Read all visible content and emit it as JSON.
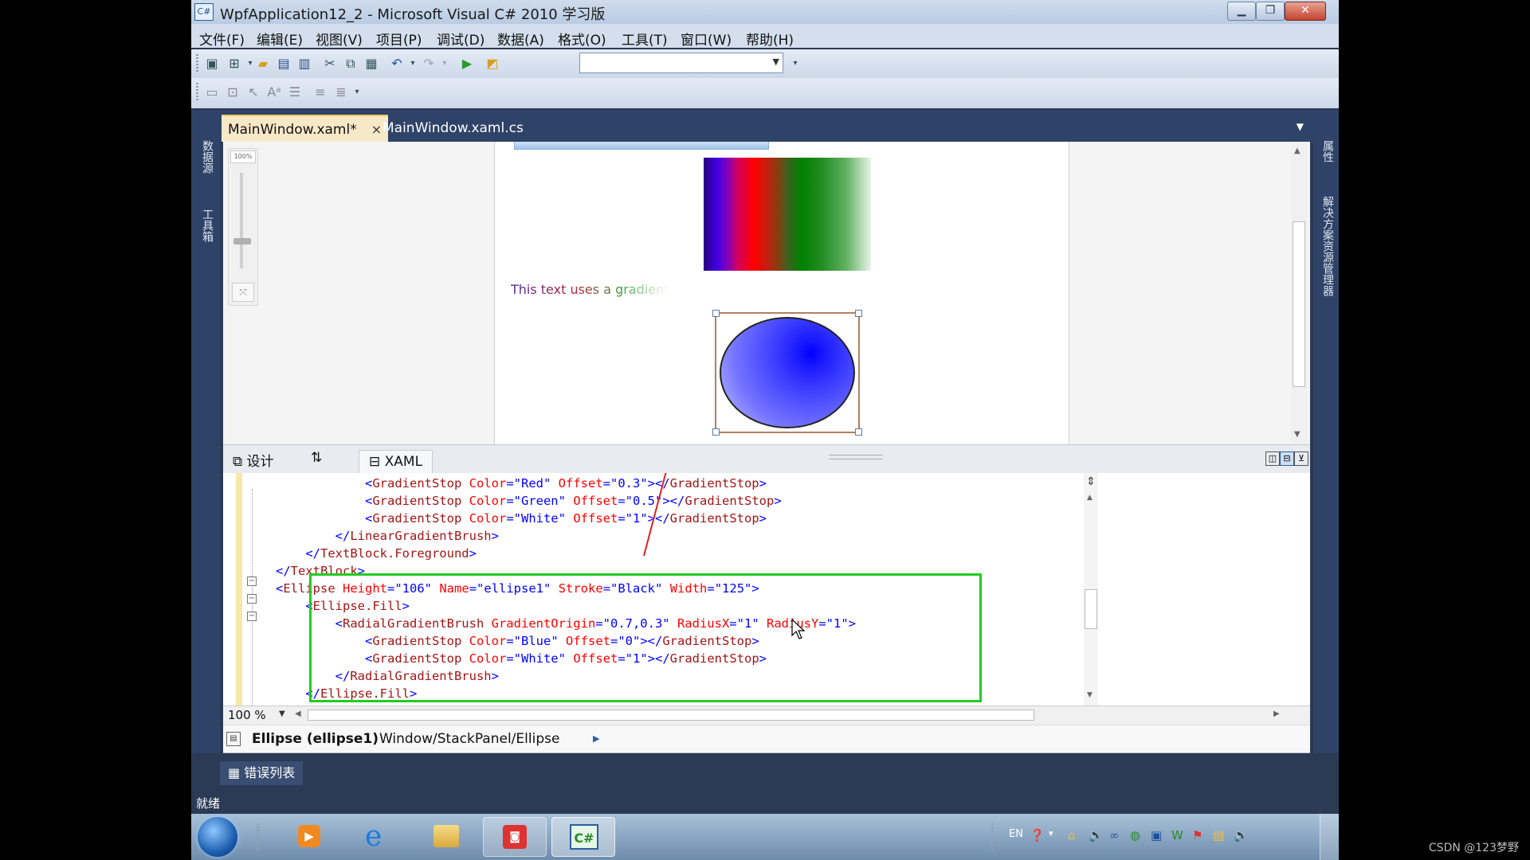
{
  "window": {
    "title": "WpfApplication12_2 - Microsoft Visual C# 2010 学习版",
    "app_icon": "C#"
  },
  "menu": [
    "文件(F)",
    "编辑(E)",
    "视图(V)",
    "项目(P)",
    "调试(D)",
    "数据(A)",
    "格式(O)",
    "工具(T)",
    "窗口(W)",
    "帮助(H)"
  ],
  "left_panel": {
    "item1": "数据源",
    "item2": "工具箱"
  },
  "right_panel": {
    "item1": "属性",
    "item2": "解决方案资源管理器"
  },
  "tabs": [
    {
      "label": "MainWindow.xaml*",
      "close": "×"
    },
    {
      "label": "MainWindow.xaml.cs"
    }
  ],
  "designer": {
    "zoom_label": "100%",
    "textblock_text": "This text uses a gradient"
  },
  "split_tabs": {
    "design": "设计",
    "swap": "⇅",
    "xaml": "XAML"
  },
  "code_lines": [
    {
      "indent": "            ",
      "parts": [
        [
          "pun",
          "<"
        ],
        [
          "tag",
          "GradientStop"
        ],
        [
          "att",
          " Color"
        ],
        [
          "pun",
          "=\""
        ],
        [
          "val",
          "Red"
        ],
        [
          "pun",
          "\""
        ],
        [
          "att",
          " Offset"
        ],
        [
          "pun",
          "=\""
        ],
        [
          "val",
          "0.3"
        ],
        [
          "pun",
          "\"></"
        ],
        [
          "tag",
          "GradientStop"
        ],
        [
          "pun",
          ">"
        ]
      ]
    },
    {
      "indent": "            ",
      "parts": [
        [
          "pun",
          "<"
        ],
        [
          "tag",
          "GradientStop"
        ],
        [
          "att",
          " Color"
        ],
        [
          "pun",
          "=\""
        ],
        [
          "val",
          "Green"
        ],
        [
          "pun",
          "\""
        ],
        [
          "att",
          " Offset"
        ],
        [
          "pun",
          "=\""
        ],
        [
          "val",
          "0.5"
        ],
        [
          "pun",
          "\"></"
        ],
        [
          "tag",
          "GradientStop"
        ],
        [
          "pun",
          ">"
        ]
      ]
    },
    {
      "indent": "            ",
      "parts": [
        [
          "pun",
          "<"
        ],
        [
          "tag",
          "GradientStop"
        ],
        [
          "att",
          " Color"
        ],
        [
          "pun",
          "=\""
        ],
        [
          "val",
          "White"
        ],
        [
          "pun",
          "\""
        ],
        [
          "att",
          " Offset"
        ],
        [
          "pun",
          "=\""
        ],
        [
          "val",
          "1"
        ],
        [
          "pun",
          "\"></"
        ],
        [
          "tag",
          "GradientStop"
        ],
        [
          "pun",
          ">"
        ]
      ]
    },
    {
      "indent": "        ",
      "parts": [
        [
          "pun",
          "</"
        ],
        [
          "tag",
          "LinearGradientBrush"
        ],
        [
          "pun",
          ">"
        ]
      ]
    },
    {
      "indent": "    ",
      "parts": [
        [
          "pun",
          "</"
        ],
        [
          "tag",
          "TextBlock.Foreground"
        ],
        [
          "pun",
          ">"
        ]
      ]
    },
    {
      "indent": "",
      "parts": [
        [
          "pun",
          "</"
        ],
        [
          "tag",
          "TextBlock"
        ],
        [
          "pun",
          ">"
        ]
      ]
    },
    {
      "indent": "",
      "parts": [
        [
          "pun",
          "<"
        ],
        [
          "tag",
          "Ellipse"
        ],
        [
          "att",
          " Height"
        ],
        [
          "pun",
          "=\""
        ],
        [
          "val",
          "106"
        ],
        [
          "pun",
          "\""
        ],
        [
          "att",
          " Name"
        ],
        [
          "pun",
          "=\""
        ],
        [
          "val",
          "ellipse1"
        ],
        [
          "pun",
          "\""
        ],
        [
          "att",
          " Stroke"
        ],
        [
          "pun",
          "=\""
        ],
        [
          "val",
          "Black"
        ],
        [
          "pun",
          "\""
        ],
        [
          "att",
          " Width"
        ],
        [
          "pun",
          "=\""
        ],
        [
          "val",
          "125"
        ],
        [
          "pun",
          "\">"
        ]
      ]
    },
    {
      "indent": "    ",
      "parts": [
        [
          "pun",
          "<"
        ],
        [
          "tag",
          "Ellipse.Fill"
        ],
        [
          "pun",
          ">"
        ]
      ]
    },
    {
      "indent": "        ",
      "parts": [
        [
          "pun",
          "<"
        ],
        [
          "tag",
          "RadialGradientBrush"
        ],
        [
          "att",
          " GradientOrigin"
        ],
        [
          "pun",
          "=\""
        ],
        [
          "val",
          "0.7,0.3"
        ],
        [
          "pun",
          "\""
        ],
        [
          "att",
          " RadiusX"
        ],
        [
          "pun",
          "=\""
        ],
        [
          "val",
          "1"
        ],
        [
          "pun",
          "\""
        ],
        [
          "att",
          " RadiusY"
        ],
        [
          "pun",
          "=\""
        ],
        [
          "val",
          "1"
        ],
        [
          "pun",
          "\">"
        ]
      ]
    },
    {
      "indent": "            ",
      "parts": [
        [
          "pun",
          "<"
        ],
        [
          "tag",
          "GradientStop"
        ],
        [
          "att",
          " Color"
        ],
        [
          "pun",
          "=\""
        ],
        [
          "val",
          "Blue"
        ],
        [
          "pun",
          "\""
        ],
        [
          "att",
          " Offset"
        ],
        [
          "pun",
          "=\""
        ],
        [
          "val",
          "0"
        ],
        [
          "pun",
          "\"></"
        ],
        [
          "tag",
          "GradientStop"
        ],
        [
          "pun",
          ">"
        ]
      ]
    },
    {
      "indent": "            ",
      "parts": [
        [
          "pun",
          "<"
        ],
        [
          "tag",
          "GradientStop"
        ],
        [
          "att",
          " Color"
        ],
        [
          "pun",
          "=\""
        ],
        [
          "val",
          "White"
        ],
        [
          "pun",
          "\""
        ],
        [
          "att",
          " Offset"
        ],
        [
          "pun",
          "=\""
        ],
        [
          "val",
          "1"
        ],
        [
          "pun",
          "\"></"
        ],
        [
          "tag",
          "GradientStop"
        ],
        [
          "pun",
          ">"
        ]
      ]
    },
    {
      "indent": "        ",
      "parts": [
        [
          "pun",
          "</"
        ],
        [
          "tag",
          "RadialGradientBrush"
        ],
        [
          "pun",
          ">"
        ]
      ]
    },
    {
      "indent": "    ",
      "parts": [
        [
          "pun",
          "</"
        ],
        [
          "tag",
          "Ellipse.Fill"
        ],
        [
          "pun",
          ">"
        ]
      ]
    }
  ],
  "zoom": {
    "value": "100 %"
  },
  "breadcrumb": {
    "element": "Ellipse (ellipse1)",
    "path": "Window/StackPanel/Ellipse"
  },
  "error_list": "错误列表",
  "status": "就绪",
  "tray": {
    "lang": "EN"
  },
  "watermark": "CSDN @123梦野",
  "colors": {
    "highlight_box": "#22cc22",
    "arrow": "#e02020",
    "ide_dark": "#2b3a55"
  }
}
